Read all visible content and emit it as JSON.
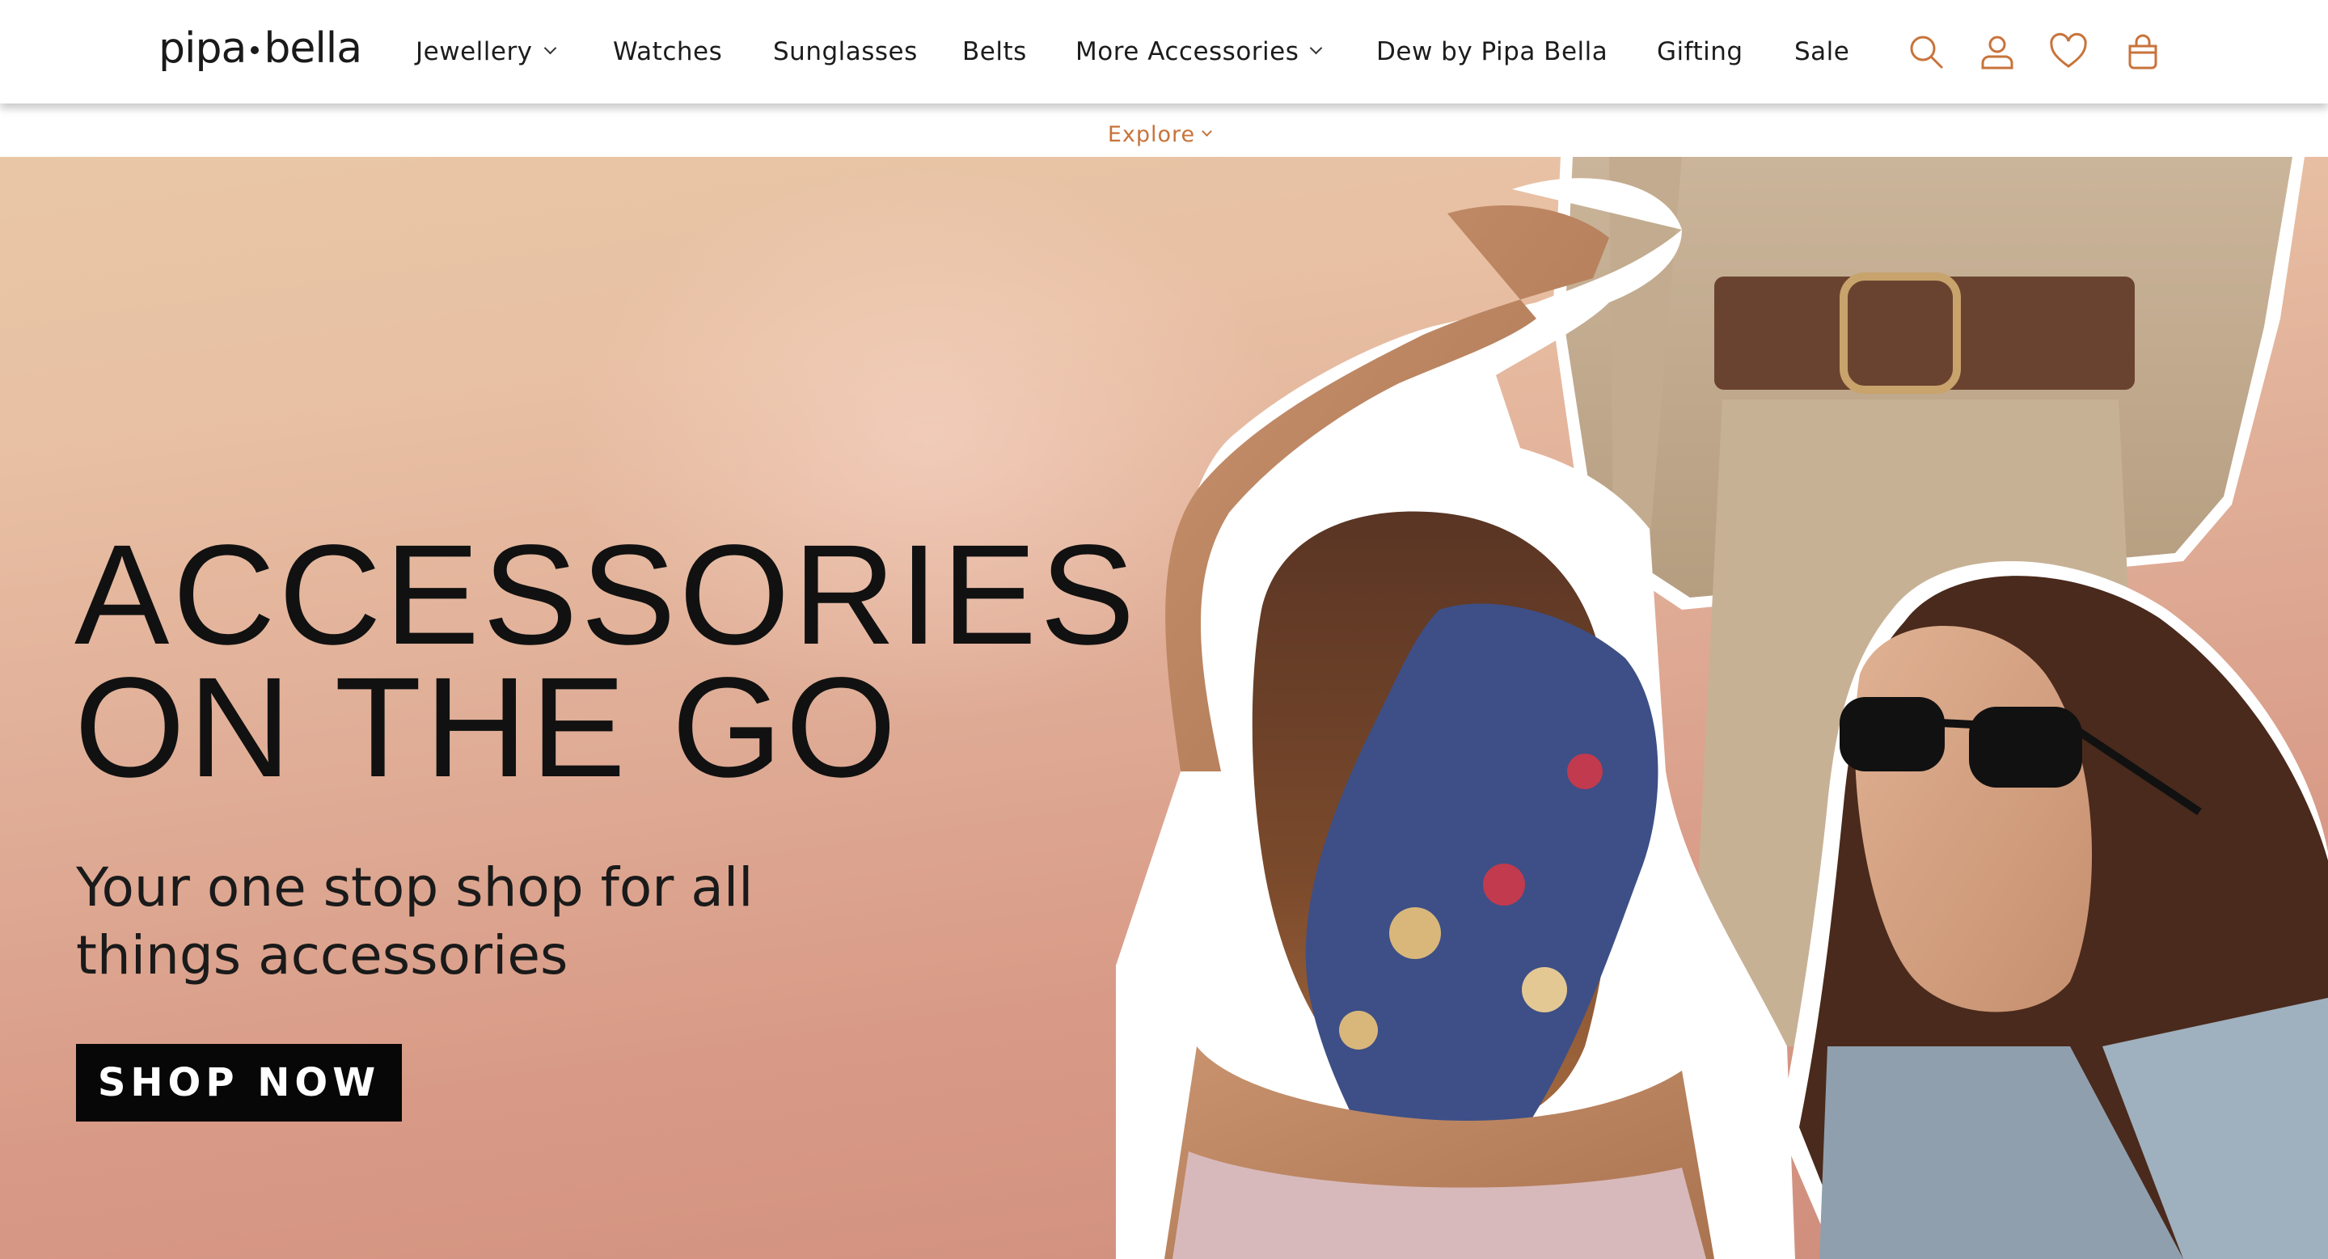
{
  "header": {
    "logo_left": "pipa",
    "logo_right": "bella",
    "nav": [
      {
        "label": "Jewellery",
        "has_dropdown": true
      },
      {
        "label": "Watches",
        "has_dropdown": false
      },
      {
        "label": "Sunglasses",
        "has_dropdown": false
      },
      {
        "label": "Belts",
        "has_dropdown": false
      },
      {
        "label": "More Accessories",
        "has_dropdown": true
      },
      {
        "label": "Dew by Pipa Bella",
        "has_dropdown": false
      },
      {
        "label": "Gifting",
        "has_dropdown": false
      },
      {
        "label": "Sale",
        "has_dropdown": false
      }
    ],
    "icons": [
      "search-icon",
      "account-icon",
      "wishlist-heart-icon",
      "cart-bag-icon"
    ],
    "icon_color": "#c8733b"
  },
  "explore": {
    "label": "Explore",
    "color": "#c8733b"
  },
  "hero": {
    "title": "ACCESSORIES\nON THE GO",
    "subtitle": "Your one stop shop for all\nthings accessories",
    "cta_label": "SHOP NOW",
    "image_subjects": [
      "woman-with-printed-hair-scarf-icon",
      "woman-with-sunglasses-icon",
      "woman-wearing-brown-belt-icon"
    ]
  }
}
